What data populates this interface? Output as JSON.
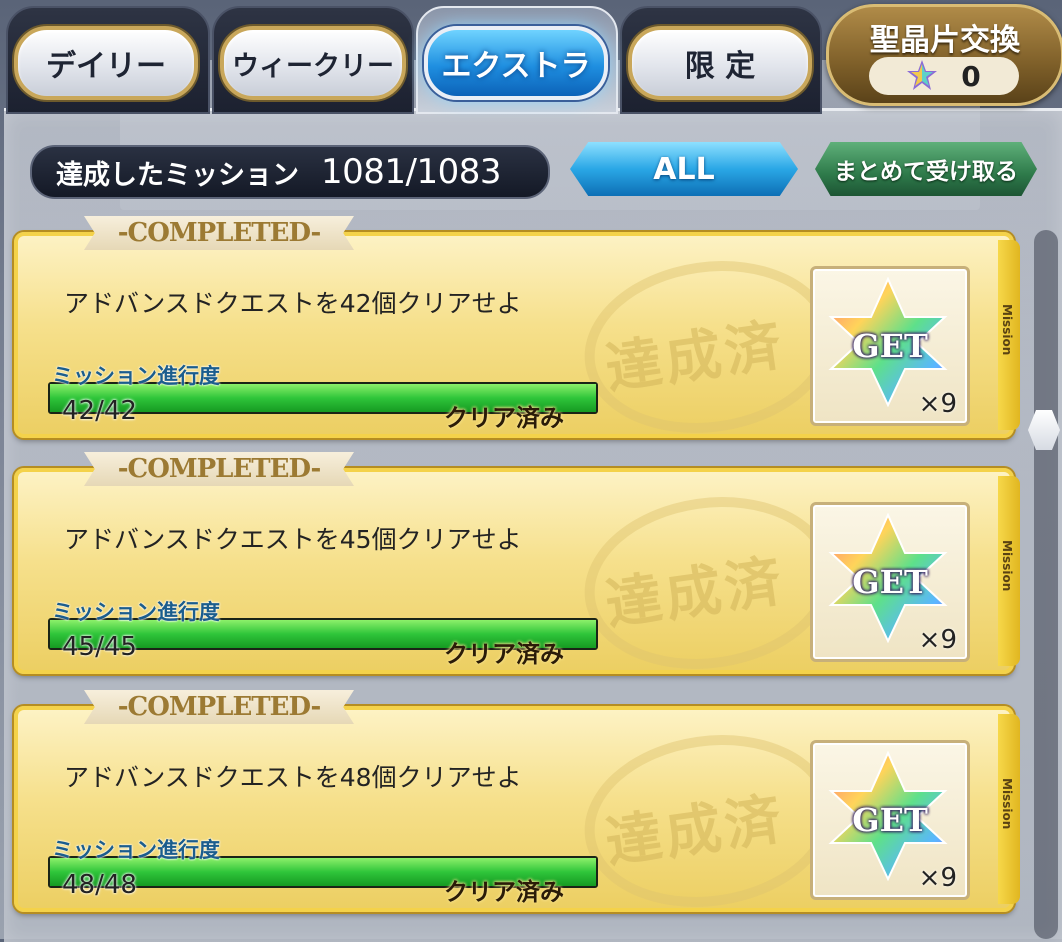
{
  "tabs": [
    {
      "label": "デイリー",
      "active": false
    },
    {
      "label": "ウィークリー",
      "active": false
    },
    {
      "label": "エクストラ",
      "active": true
    },
    {
      "label": "限 定",
      "active": false
    }
  ],
  "exchange": {
    "label": "聖晶片交換",
    "count": "0",
    "icon": "quartz-fragment-icon"
  },
  "summary": {
    "label": "達成したミッション",
    "value": "1081/1083"
  },
  "filter": {
    "label": "ALL"
  },
  "bulk_receive": {
    "label": "まとめて受け取る"
  },
  "progress_label": "ミッション進行度",
  "cleared_label": "クリア済み",
  "completed_label": "-COMPLETED-",
  "stamp_label": "達成済",
  "side_label": "Mission",
  "get_label": "GET",
  "missions": [
    {
      "text": "アドバンスドクエストを42個クリアせよ",
      "progress": "42/42",
      "fraction": 1.0,
      "reward_qty": "×9"
    },
    {
      "text": "アドバンスドクエストを45個クリアせよ",
      "progress": "45/45",
      "fraction": 1.0,
      "reward_qty": "×9"
    },
    {
      "text": "アドバンスドクエストを48個クリアせよ",
      "progress": "48/48",
      "fraction": 1.0,
      "reward_qty": "×9"
    }
  ],
  "colors": {
    "active_tab": "#1f8fe0",
    "card": "#f6e08c",
    "progress": "#2fc53a",
    "receive": "#2e7a4a"
  }
}
